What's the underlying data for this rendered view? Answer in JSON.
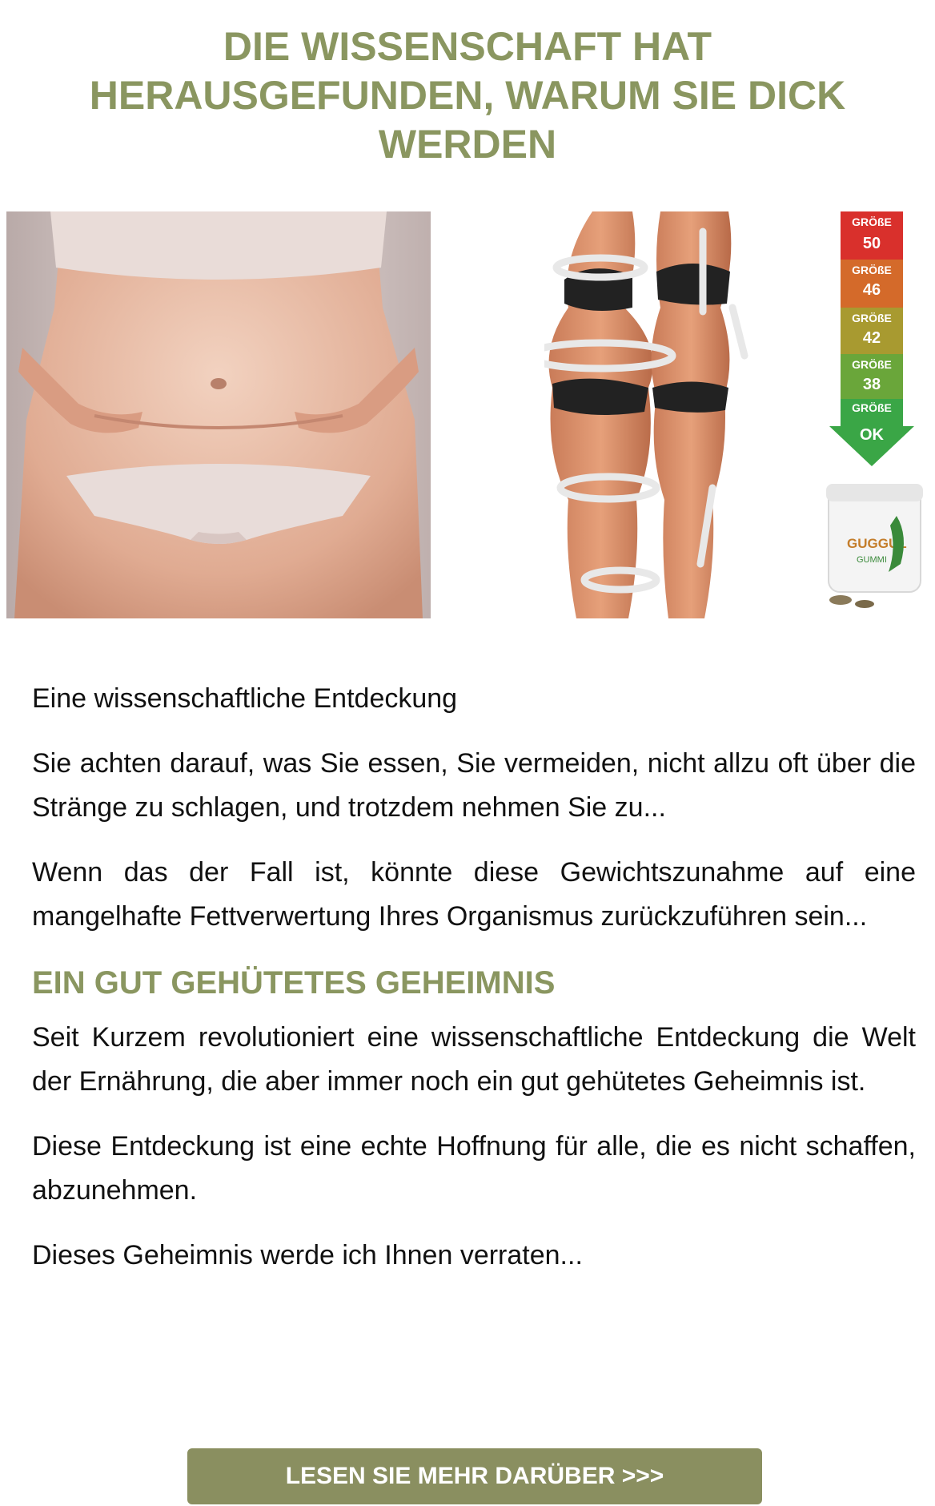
{
  "headline": "DIE WISSENSCHAFT HAT HERAUSGEFUNDEN, WARUM SIE DICK WERDEN",
  "size_chart": [
    {
      "label": "GRÖßE",
      "size": "50",
      "color": "#d9302c"
    },
    {
      "label": "GRÖßE",
      "size": "46",
      "color": "#d46a2a"
    },
    {
      "label": "GRÖßE",
      "size": "42",
      "color": "#a89a30"
    },
    {
      "label": "GRÖßE",
      "size": "38",
      "color": "#6aa63a"
    },
    {
      "label": "GRÖßE",
      "size": "OK",
      "color": "#3aa646"
    }
  ],
  "product": {
    "brand": "GUGGUL",
    "sub": "GUMMI"
  },
  "paragraphs": {
    "p1": "Eine wissenschaftliche Entdeckung",
    "p2": "Sie achten darauf, was Sie essen, Sie vermeiden, nicht allzu oft über die Stränge zu schlagen, und trotzdem nehmen Sie zu...",
    "p3": "Wenn das der Fall ist, könnte diese Gewichtszunahme auf eine mangelhafte Fettverwertung Ihres Organismus zurückzuführen sein...",
    "subheading": "EIN GUT GEHÜTETES GEHEIMNIS",
    "p4": "Seit Kurzem revolutioniert eine wissenschaftliche Entdeckung die Welt der Ernährung, die aber immer noch ein gut gehütetes Geheimnis ist.",
    "p5": "Diese Entdeckung ist eine echte Hoffnung für alle, die es nicht schaffen, abzunehmen.",
    "p6": "Dieses Geheimnis werde ich Ihnen verraten..."
  },
  "cta": {
    "label": "LESEN SIE MEHR DARÜBER >>>"
  },
  "colors": {
    "accent": "#8a9660",
    "button": "#8a8f60"
  }
}
